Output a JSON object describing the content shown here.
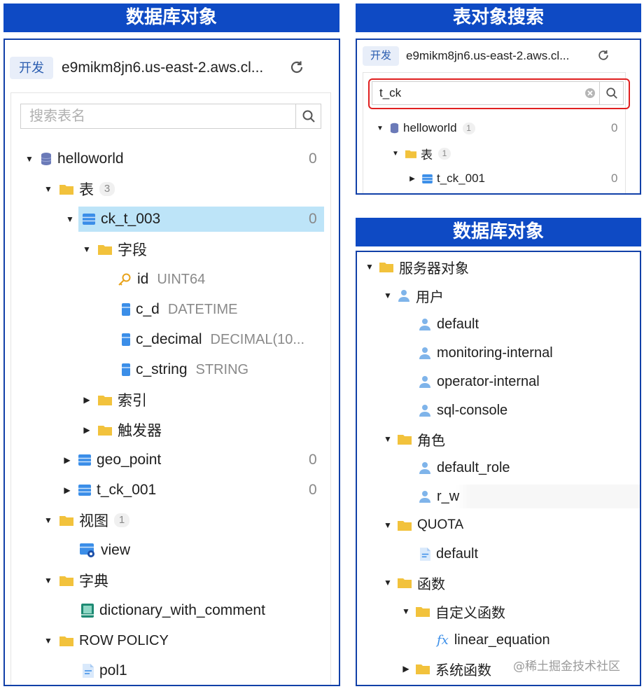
{
  "left": {
    "title": "数据库对象",
    "conn": {
      "env": "开发",
      "host": "e9mikm8jn6.us-east-2.aws.cl..."
    },
    "search_placeholder": "搜索表名",
    "tree": [
      {
        "label": "helloworld",
        "count": "0"
      },
      {
        "label": "表",
        "badge": "3"
      },
      {
        "label": "ck_t_003",
        "count": "0"
      },
      {
        "label": "字段"
      },
      {
        "label": "id",
        "type": "UINT64"
      },
      {
        "label": "c_d",
        "type": "DATETIME"
      },
      {
        "label": "c_decimal",
        "type": "DECIMAL(10..."
      },
      {
        "label": "c_string",
        "type": "STRING"
      },
      {
        "label": "索引"
      },
      {
        "label": "触发器"
      },
      {
        "label": "geo_point",
        "count": "0"
      },
      {
        "label": "t_ck_001",
        "count": "0"
      },
      {
        "label": "视图",
        "badge": "1"
      },
      {
        "label": "view"
      },
      {
        "label": "字典"
      },
      {
        "label": "dictionary_with_comment"
      },
      {
        "label": "ROW POLICY"
      },
      {
        "label": "pol1"
      }
    ]
  },
  "right_top": {
    "title": "表对象搜索",
    "conn": {
      "env": "开发",
      "host": "e9mikm8jn6.us-east-2.aws.cl..."
    },
    "search_value": "t_ck",
    "tree": [
      {
        "label": "helloworld",
        "badge": "1",
        "count": "0"
      },
      {
        "label": "表",
        "badge": "1"
      },
      {
        "label": "t_ck_001",
        "count": "0"
      }
    ]
  },
  "right_bottom": {
    "title": "数据库对象",
    "tree": [
      {
        "label": "服务器对象"
      },
      {
        "label": "用户"
      },
      {
        "label": "default"
      },
      {
        "label": "monitoring-internal"
      },
      {
        "label": "operator-internal"
      },
      {
        "label": "sql-console"
      },
      {
        "label": "角色"
      },
      {
        "label": "default_role"
      },
      {
        "label": "r_w"
      },
      {
        "label": "QUOTA"
      },
      {
        "label": "default"
      },
      {
        "label": "函数"
      },
      {
        "label": "自定义函数"
      },
      {
        "label": "linear_equation"
      },
      {
        "label": "系统函数"
      }
    ]
  },
  "watermark": "@稀土掘金技术社区",
  "colors": {
    "banner": "#0e4ac4",
    "selected_row": "#bde4f8",
    "folder": "#f2c23c",
    "table_icon": "#3b8ee8",
    "highlight": "#e02020"
  }
}
